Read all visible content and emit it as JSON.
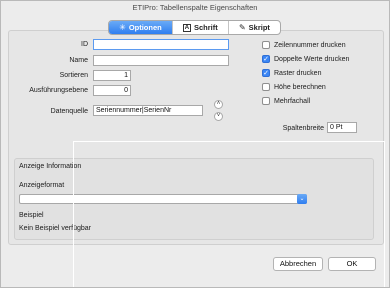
{
  "window": {
    "title": "ETIPro: Tabellenspalte Eigenschaften"
  },
  "tabs": [
    {
      "label": "Optionen",
      "icon": "gear-icon",
      "active": true
    },
    {
      "label": "Schrift",
      "icon": "font-icon",
      "active": false
    },
    {
      "label": "Skript",
      "icon": "script-icon",
      "active": false
    }
  ],
  "form": {
    "id_label": "ID",
    "id_value": "",
    "name_label": "Name",
    "name_value": "",
    "sort_label": "Sortieren",
    "sort_value": "1",
    "level_label": "Ausführungsebene",
    "level_value": "0",
    "source_label": "Datenquelle",
    "source_value": "Seriennummer|SerienNr"
  },
  "checkboxes": [
    {
      "label": "Zeilennummer drucken",
      "checked": false
    },
    {
      "label": "Doppelte Werte drucken",
      "checked": true
    },
    {
      "label": "Raster drucken",
      "checked": true
    },
    {
      "label": "Höhe berechnen",
      "checked": false
    },
    {
      "label": "Mehrfachall",
      "checked": false
    }
  ],
  "column_width": {
    "label": "Spaltenbreite",
    "value": "0 Pt"
  },
  "display": {
    "group_label": "Anzeige Information",
    "format_label": "Anzeigeformat",
    "format_value": "",
    "example_label": "Beispiel",
    "example_value": "Kein Beispiel verfügbar"
  },
  "buttons": {
    "cancel": "Abbrechen",
    "ok": "OK"
  },
  "colors": {
    "accent": "#3b86f5",
    "panel": "#e6e6e6",
    "window": "#ececec"
  }
}
